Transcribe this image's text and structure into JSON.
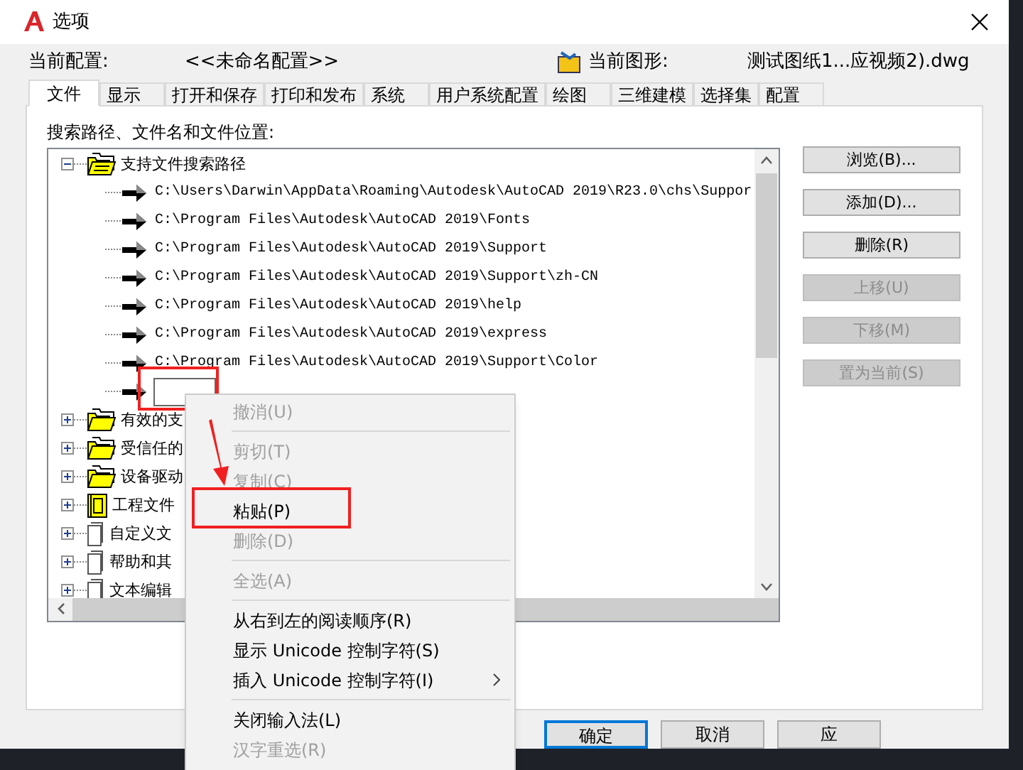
{
  "window": {
    "title": "选项"
  },
  "profile": {
    "label": "当前配置:",
    "value": "<<未命名配置>>"
  },
  "drawing": {
    "label": "当前图形:",
    "value": "测试图纸1...应视频2).dwg"
  },
  "tabs": [
    {
      "label": "文件",
      "selected": true
    },
    {
      "label": "显示",
      "selected": false
    },
    {
      "label": "打开和保存",
      "selected": false
    },
    {
      "label": "打印和发布",
      "selected": false
    },
    {
      "label": "系统",
      "selected": false
    },
    {
      "label": "用户系统配置",
      "selected": false
    },
    {
      "label": "绘图",
      "selected": false
    },
    {
      "label": "三维建模",
      "selected": false
    },
    {
      "label": "选择集",
      "selected": false
    },
    {
      "label": "配置",
      "selected": false
    }
  ],
  "panel_label": "搜索路径、文件名和文件位置:",
  "tree": [
    {
      "label": "支持文件搜索路径",
      "kind": "folder",
      "expanded": true,
      "children": [
        {
          "kind": "path",
          "label": "C:\\Users\\Darwin\\AppData\\Roaming\\Autodesk\\AutoCAD 2019\\R23.0\\chs\\Suppor"
        },
        {
          "kind": "path",
          "label": "C:\\Program Files\\Autodesk\\AutoCAD 2019\\Fonts"
        },
        {
          "kind": "path",
          "label": "C:\\Program Files\\Autodesk\\AutoCAD 2019\\Support"
        },
        {
          "kind": "path",
          "label": "C:\\Program Files\\Autodesk\\AutoCAD 2019\\Support\\zh-CN"
        },
        {
          "kind": "path",
          "label": "C:\\Program Files\\Autodesk\\AutoCAD 2019\\help"
        },
        {
          "kind": "path",
          "label": "C:\\Program Files\\Autodesk\\AutoCAD 2019\\express"
        },
        {
          "kind": "path",
          "label": "C:\\Program Files\\Autodesk\\AutoCAD 2019\\Support\\Color"
        },
        {
          "kind": "editing"
        }
      ]
    },
    {
      "label": "有效的支",
      "kind": "folder",
      "expanded": false
    },
    {
      "label": "受信任的",
      "kind": "folder",
      "expanded": false
    },
    {
      "label": "设备驱动",
      "kind": "folder",
      "expanded": false
    },
    {
      "label": "工程文件",
      "kind": "project",
      "expanded": false
    },
    {
      "label": "自定义文",
      "kind": "document",
      "expanded": false
    },
    {
      "label": "帮助和其",
      "kind": "document",
      "expanded": false
    },
    {
      "label": "文本编辑",
      "kind": "document",
      "expanded": false
    }
  ],
  "side_buttons": [
    {
      "label": "浏览(B)...",
      "disabled": false
    },
    {
      "label": "添加(D)...",
      "disabled": false
    },
    {
      "label": "删除(R)",
      "disabled": false
    },
    {
      "label": "上移(U)",
      "disabled": true
    },
    {
      "label": "下移(M)",
      "disabled": true
    },
    {
      "label": "置为当前(S)",
      "disabled": true
    }
  ],
  "context_menu": [
    {
      "kind": "item",
      "label": "撤消(U)",
      "disabled": true
    },
    {
      "kind": "separator"
    },
    {
      "kind": "item",
      "label": "剪切(T)",
      "disabled": true
    },
    {
      "kind": "item",
      "label": "复制(C)",
      "disabled": true
    },
    {
      "kind": "item",
      "label": "粘贴(P)",
      "disabled": false
    },
    {
      "kind": "item",
      "label": "删除(D)",
      "disabled": true
    },
    {
      "kind": "separator"
    },
    {
      "kind": "item",
      "label": "全选(A)",
      "disabled": true
    },
    {
      "kind": "separator"
    },
    {
      "kind": "item",
      "label": "从右到左的阅读顺序(R)",
      "disabled": false
    },
    {
      "kind": "item",
      "label": "显示 Unicode 控制字符(S)",
      "disabled": false
    },
    {
      "kind": "submenu",
      "label": "插入 Unicode 控制字符(I)",
      "disabled": false
    },
    {
      "kind": "separator"
    },
    {
      "kind": "item",
      "label": "关闭输入法(L)",
      "disabled": false
    },
    {
      "kind": "item",
      "label": "汉字重选(R)",
      "disabled": true
    }
  ],
  "footer_buttons": [
    {
      "label": "确定",
      "focused": true
    },
    {
      "label": "取消",
      "focused": false
    },
    {
      "label": "应",
      "focused": false
    }
  ]
}
